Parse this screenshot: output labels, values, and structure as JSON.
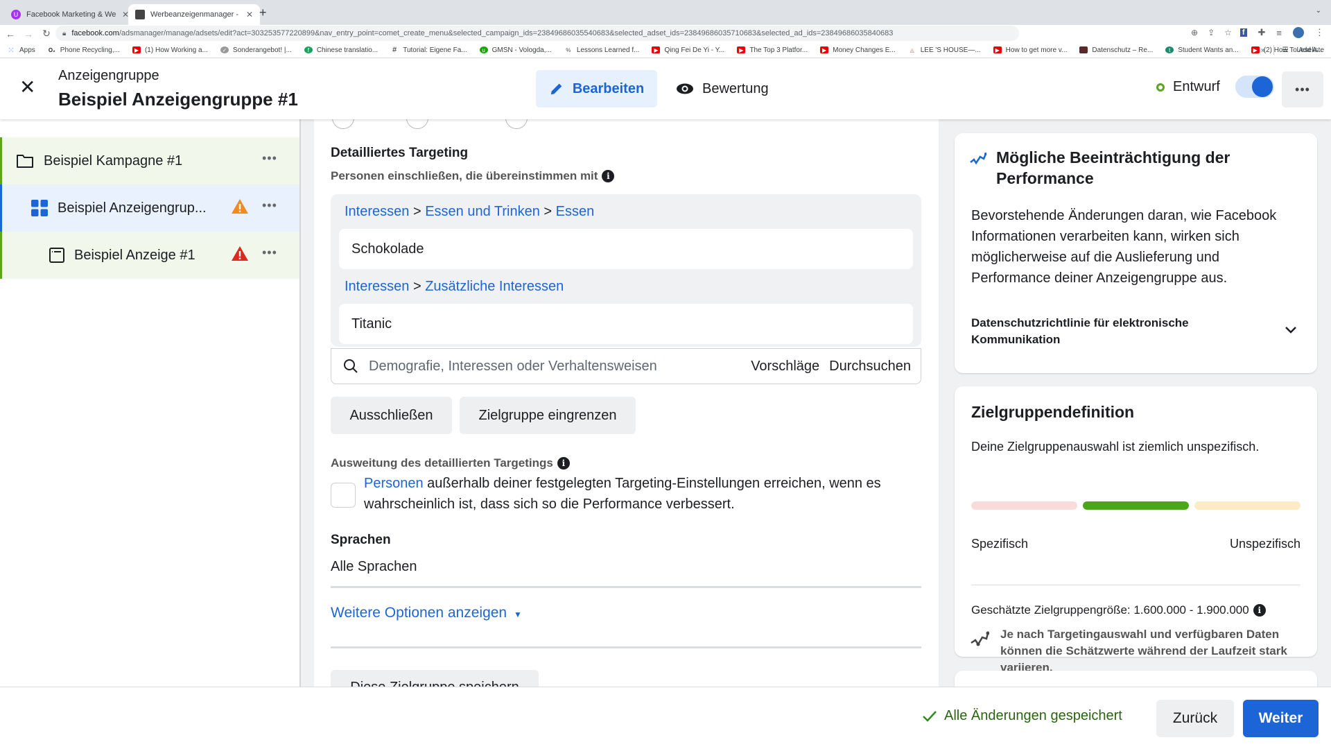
{
  "browser": {
    "tabs": [
      {
        "title": "Facebook Marketing & Werbea",
        "active": false,
        "favicon": "udemy-icon",
        "color": "#a435f0"
      },
      {
        "title": "Werbeanzeigenmanager - Wer",
        "active": true,
        "favicon": "ads-manager-icon",
        "color": "#444"
      }
    ],
    "new_tab": "+",
    "url_host": "facebook.com",
    "url_path": "/adsmanager/manage/adsets/edit?act=303253577220899&nav_entry_point=comet_create_menu&selected_campaign_ids=23849686035540683&selected_adset_ids=23849686035710683&selected_ad_ids=23849686035840683",
    "bookmarks": [
      {
        "label": "Apps",
        "icon": "apps-grid-icon",
        "color": "#4285f4"
      },
      {
        "label": "Phone Recycling,...",
        "icon": "o2-icon",
        "color": "#1c1e21"
      },
      {
        "label": "(1) How Working a...",
        "icon": "youtube-icon",
        "color": "#e00"
      },
      {
        "label": "Sonderangebot! |...",
        "icon": "badge-icon",
        "color": "#777"
      },
      {
        "label": "Chinese translatio...",
        "icon": "fi-icon",
        "color": "#1aa260"
      },
      {
        "label": "Tutorial: Eigene Fa...",
        "icon": "hash-icon",
        "color": "#1c1e21"
      },
      {
        "label": "GMSN - Vologda,...",
        "icon": "upwork-icon",
        "color": "#14a800"
      },
      {
        "label": "Lessons Learned f...",
        "icon": "percent-icon",
        "color": "#555"
      },
      {
        "label": "Qing Fei De Yi - Y...",
        "icon": "youtube-icon",
        "color": "#e00"
      },
      {
        "label": "The Top 3 Platfor...",
        "icon": "youtube-icon",
        "color": "#e00"
      },
      {
        "label": "Money Changes E...",
        "icon": "youtube-icon",
        "color": "#e00"
      },
      {
        "label": "LEE 'S HOUSE—...",
        "icon": "airbnb-icon",
        "color": "#ff5a5f"
      },
      {
        "label": "How to get more v...",
        "icon": "youtube-icon",
        "color": "#e00"
      },
      {
        "label": "Datenschutz – Re...",
        "icon": "image-icon",
        "color": "#5a2a2a"
      },
      {
        "label": "Student Wants an...",
        "icon": "t-icon",
        "color": "#1d8a6b"
      },
      {
        "label": "(2) How To Add A...",
        "icon": "youtube-icon",
        "color": "#e00"
      }
    ],
    "bookmarks_overflow": "»",
    "reading_list": "Leseliste"
  },
  "header": {
    "subtitle": "Anzeigengruppe",
    "title": "Beispiel Anzeigengruppe #1",
    "edit_label": "Bearbeiten",
    "review_label": "Bewertung",
    "status_label": "Entwurf",
    "toggle_on": true,
    "more_label": "•••"
  },
  "sidebar": {
    "items": [
      {
        "label": "Beispiel Kampagne #1",
        "type": "campaign",
        "warning": null
      },
      {
        "label": "Beispiel Anzeigengrup...",
        "type": "adset",
        "warning": "orange"
      },
      {
        "label": "Beispiel Anzeige #1",
        "type": "ad",
        "warning": "red"
      }
    ],
    "more_label": "•••",
    "colors": {
      "warning_orange": "#f28b1e",
      "warning_red": "#d92b1e"
    }
  },
  "main": {
    "detailed_targeting": {
      "title": "Detailliertes Targeting",
      "subtitle": "Personen einschließen, die übereinstimmen mit",
      "groups": [
        {
          "path": [
            "Interessen",
            "Essen und Trinken",
            "Essen"
          ],
          "value": "Schokolade"
        },
        {
          "path": [
            "Interessen",
            "Zusätzliche Interessen"
          ],
          "value": "Titanic"
        }
      ],
      "separator": ">",
      "search_placeholder": "Demografie, Interessen oder Verhaltensweisen",
      "suggestions_label": "Vorschläge",
      "browse_label": "Durchsuchen",
      "exclude_label": "Ausschließen",
      "narrow_label": "Zielgruppe eingrenzen"
    },
    "expansion": {
      "title": "Ausweitung des detaillierten Targetings",
      "link": "Personen",
      "text": " außerhalb deiner festgelegten Targeting-Einstellungen erreichen, wenn es wahrscheinlich ist, dass sich so die Performance verbessert.",
      "checked": false
    },
    "languages": {
      "title": "Sprachen",
      "value": "Alle Sprachen"
    },
    "more_options": "Weitere Optionen anzeigen",
    "save_audience": "Diese Zielgruppe speichern"
  },
  "right": {
    "performance_card": {
      "title": "Mögliche Beeinträchtigung der Performance",
      "text": "Bevorstehende Änderungen daran, wie Facebook Informationen verarbeiten kann, wirken sich möglicherweise auf die Auslieferung und Performance deiner Anzeigengruppe aus.",
      "policy": "Datenschutzrichtlinie für elektronische Kommunikation"
    },
    "audience_card": {
      "title": "Zielgruppendefinition",
      "description": "Deine Zielgruppenauswahl ist ziemlich unspezifisch.",
      "meter_segments": 3,
      "meter_active_segment": 2,
      "label_left": "Spezifisch",
      "label_right": "Unspezifisch",
      "size_label": "Geschätzte Zielgruppengröße: 1.600.000 - 1.900.000",
      "note": "Je nach Targetingauswahl und verfügbaren Daten können die Schätzwerte während der Laufzeit stark variieren.",
      "colors": {
        "specific": "#fadbdc",
        "active": "#4aa818",
        "unspecific": "#fdebc6"
      }
    }
  },
  "footer": {
    "saved_label": "Alle Änderungen gespeichert",
    "back_label": "Zurück",
    "next_label": "Weiter"
  }
}
